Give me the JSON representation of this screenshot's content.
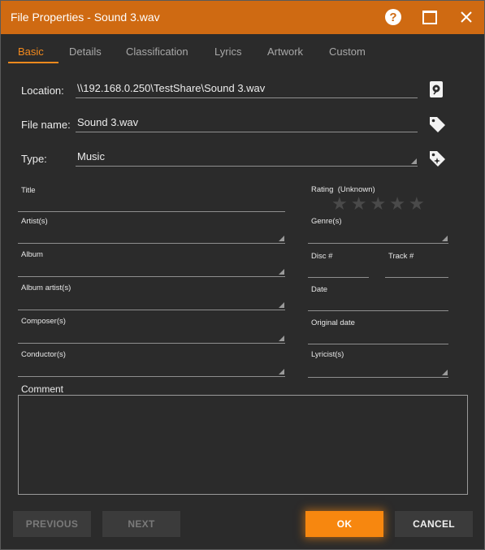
{
  "window": {
    "title": "File Properties - Sound 3.wav",
    "help": "?"
  },
  "tabs": [
    {
      "label": "Basic"
    },
    {
      "label": "Details"
    },
    {
      "label": "Classification"
    },
    {
      "label": "Lyrics"
    },
    {
      "label": "Artwork"
    },
    {
      "label": "Custom"
    }
  ],
  "location": {
    "label": "Location:",
    "value": "\\\\192.168.0.250\\TestShare\\Sound 3.wav"
  },
  "filename": {
    "label": "File name:",
    "value": "Sound 3.wav"
  },
  "type": {
    "label": "Type:",
    "value": "Music"
  },
  "fields": {
    "title": "Title",
    "artists": "Artist(s)",
    "album": "Album",
    "album_artists": "Album artist(s)",
    "composers": "Composer(s)",
    "conductors": "Conductor(s)",
    "rating": "Rating",
    "rating_value": "(Unknown)",
    "genres": "Genre(s)",
    "disc": "Disc #",
    "track": "Track #",
    "date": "Date",
    "original_date": "Original date",
    "lyricists": "Lyricist(s)",
    "comment": "Comment"
  },
  "rating_stars": {
    "filled": 0,
    "total": 5,
    "glyph": "★"
  },
  "buttons": {
    "previous": "PREVIOUS",
    "next": "NEXT",
    "ok": "OK",
    "cancel": "CANCEL"
  },
  "colors": {
    "accent": "#f38a1d",
    "titlebar": "#cf6a12",
    "background": "#2b2b2b"
  }
}
